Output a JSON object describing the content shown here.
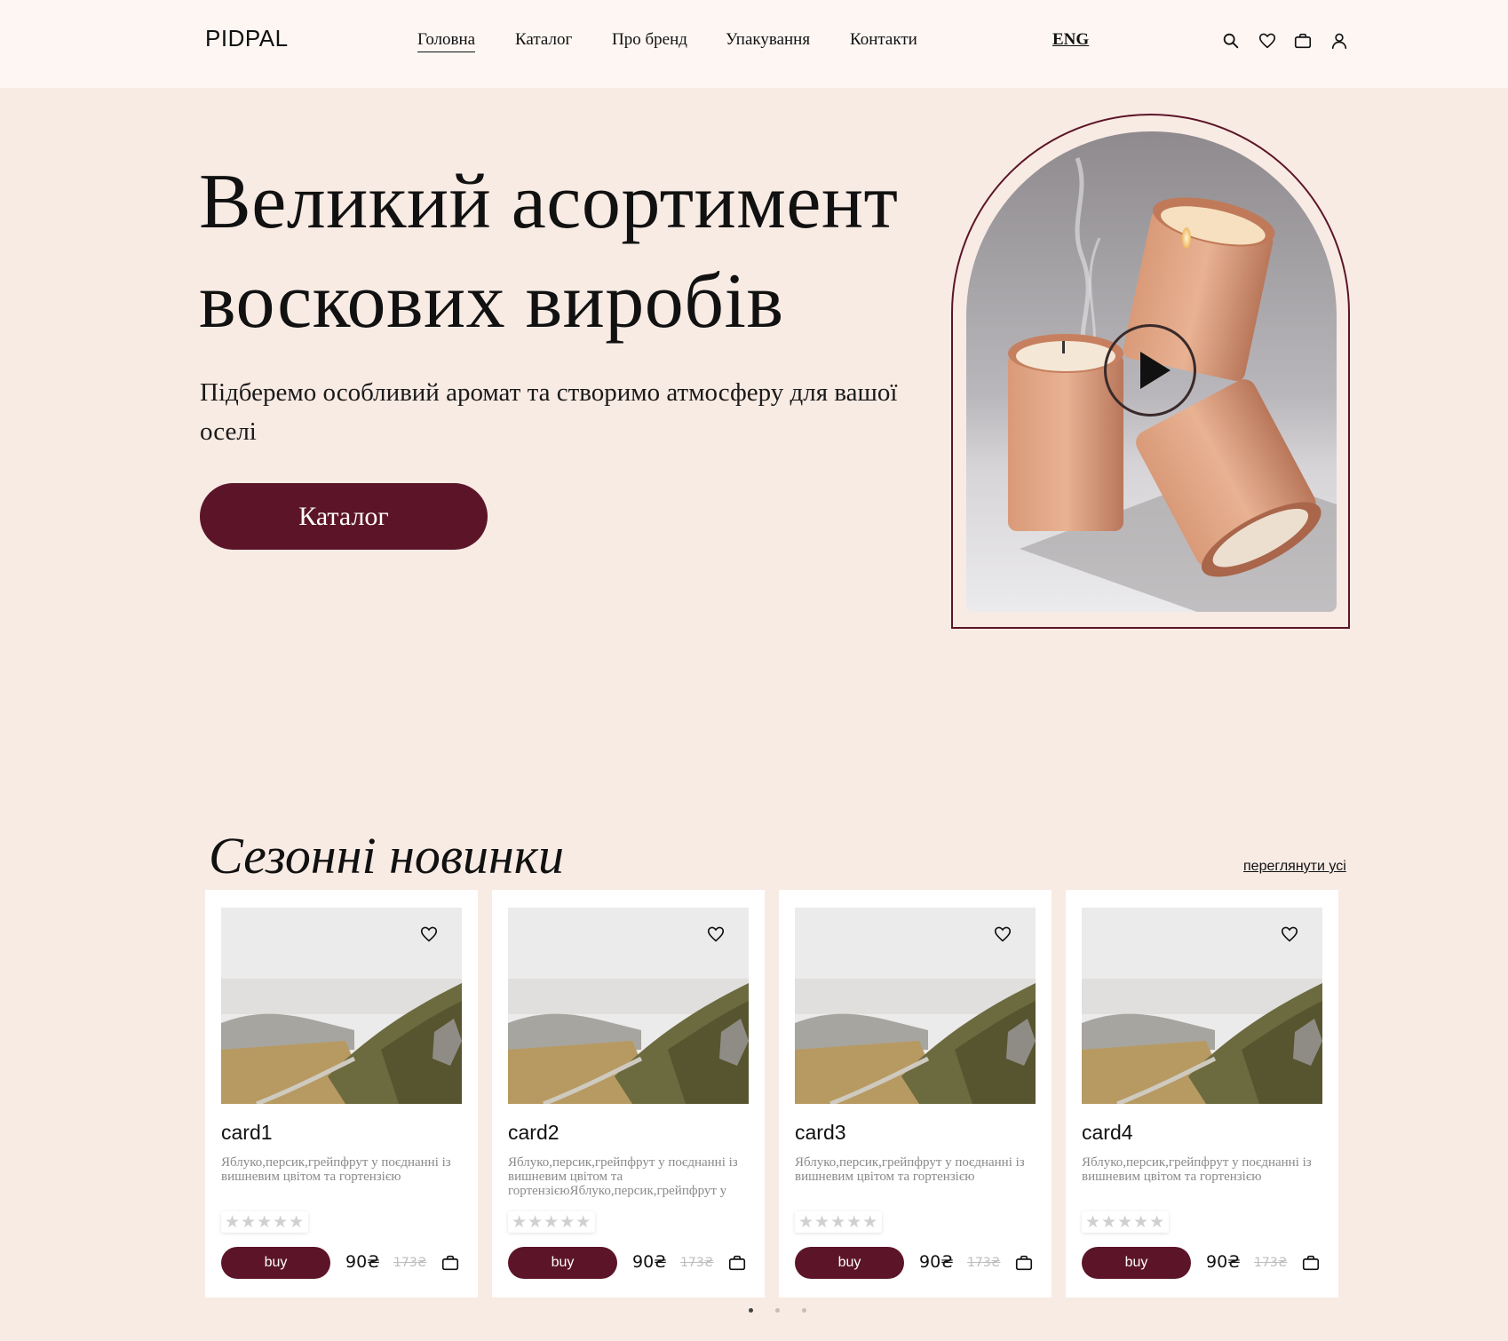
{
  "brand": {
    "logo": "PIDPAL"
  },
  "nav": {
    "items": [
      {
        "label": "Головна",
        "active": true
      },
      {
        "label": "Каталог",
        "active": false
      },
      {
        "label": "Про бренд",
        "active": false
      },
      {
        "label": "Упакування",
        "active": false
      },
      {
        "label": "Контакти",
        "active": false
      }
    ],
    "language": "ENG"
  },
  "header_icons": [
    "search-icon",
    "heart-icon",
    "bag-icon",
    "user-icon"
  ],
  "hero": {
    "title": "Великий асортимент воскових виробів",
    "subtitle": "Підберемо особливий аромат та створимо атмосферу для вашої оселі",
    "button_label": "Каталог"
  },
  "section": {
    "title": "Сезонні новинки",
    "see_all": "переглянути усі"
  },
  "cards": [
    {
      "title": "card1",
      "description": "Яблуко,персик,грейпфрут у поєднанні із вишневим цвітом та гортензією",
      "stars": "★★★★★",
      "buy_label": "buy",
      "price": "90₴",
      "old_price": "173₴"
    },
    {
      "title": "card2",
      "description": "Яблуко,персик,грейпфрут у поєднанні із вишневим цвітом та гортензієюЯблуко,персик,грейпфрут у поєднанні",
      "stars": "★★★★★",
      "buy_label": "buy",
      "price": "90₴",
      "old_price": "173₴"
    },
    {
      "title": "card3",
      "description": "Яблуко,персик,грейпфрут у поєднанні із вишневим цвітом та гортензією",
      "stars": "★★★★★",
      "buy_label": "buy",
      "price": "90₴",
      "old_price": "173₴"
    },
    {
      "title": "card4",
      "description": "Яблуко,персик,грейпфрут у поєднанні із вишневим цвітом та гортензією",
      "stars": "★★★★★",
      "buy_label": "buy",
      "price": "90₴",
      "old_price": "173₴"
    }
  ],
  "pagination": {
    "pages": 3,
    "current": 1
  },
  "colors": {
    "accent": "#5c1528",
    "background": "#f8ebe4",
    "header_background": "#fdf6f3"
  }
}
